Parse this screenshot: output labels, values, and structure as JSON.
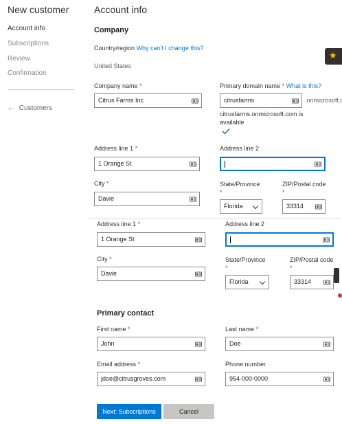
{
  "nav": {
    "title": "New customer",
    "items": [
      {
        "label": "Account info"
      },
      {
        "label": "Subscriptions"
      },
      {
        "label": "Review"
      },
      {
        "label": "Confirmation"
      }
    ],
    "back_label": "Customers"
  },
  "page": {
    "title": "Account info"
  },
  "company": {
    "section_title": "Company",
    "country_label": "Country/region",
    "country_link": "Why can't I change this?",
    "country_value": "United States",
    "company_name_label": "Company name",
    "company_name_value": "Citrus Farms Inc",
    "domain_label": "Primary domain name",
    "domain_link": "What is this?",
    "domain_value": "citrusfarms",
    "domain_suffix": ".onmicrosoft.com",
    "domain_status": "citrusfarms.onmicrosoft.com is available",
    "required_mark": "*"
  },
  "address1": {
    "line1_label": "Address line 1",
    "line1_value": "1 Orange St",
    "line2_label": "Address line 2",
    "line2_value": "",
    "city_label": "City",
    "city_value": "Davie",
    "state_label": "State/Province",
    "state_value": "Florida",
    "zip_label": "ZIP/Postal code",
    "zip_value": "33314"
  },
  "address2": {
    "line1_label": "Address line 1",
    "line1_value": "1 Orange St",
    "line2_label": "Address line 2",
    "line2_value": "",
    "city_label": "City",
    "city_value": "Davie",
    "state_label": "State/Province",
    "state_value": "Florida",
    "zip_label": "ZIP/Postal code",
    "zip_value": "33314"
  },
  "contact": {
    "section_title": "Primary contact",
    "first_name_label": "First name",
    "first_name_value": "John",
    "last_name_label": "Last name",
    "last_name_value": "Doe",
    "email_label": "Email address",
    "email_value": "jdoe@citrusgroves.com",
    "phone_label": "Phone number",
    "phone_value": "954-000-0000"
  },
  "actions": {
    "next_label": "Next: Subscriptions",
    "cancel_label": "Cancel"
  },
  "icons": {
    "star": "star-icon",
    "check": "check-icon",
    "back": "arrow-left-icon",
    "contact_card": "contact-card-icon",
    "chevron": "chevron-down-icon"
  },
  "colors": {
    "accent": "#0078d4",
    "required": "#d13438",
    "success": "#107c10",
    "star": "#ffb900"
  }
}
